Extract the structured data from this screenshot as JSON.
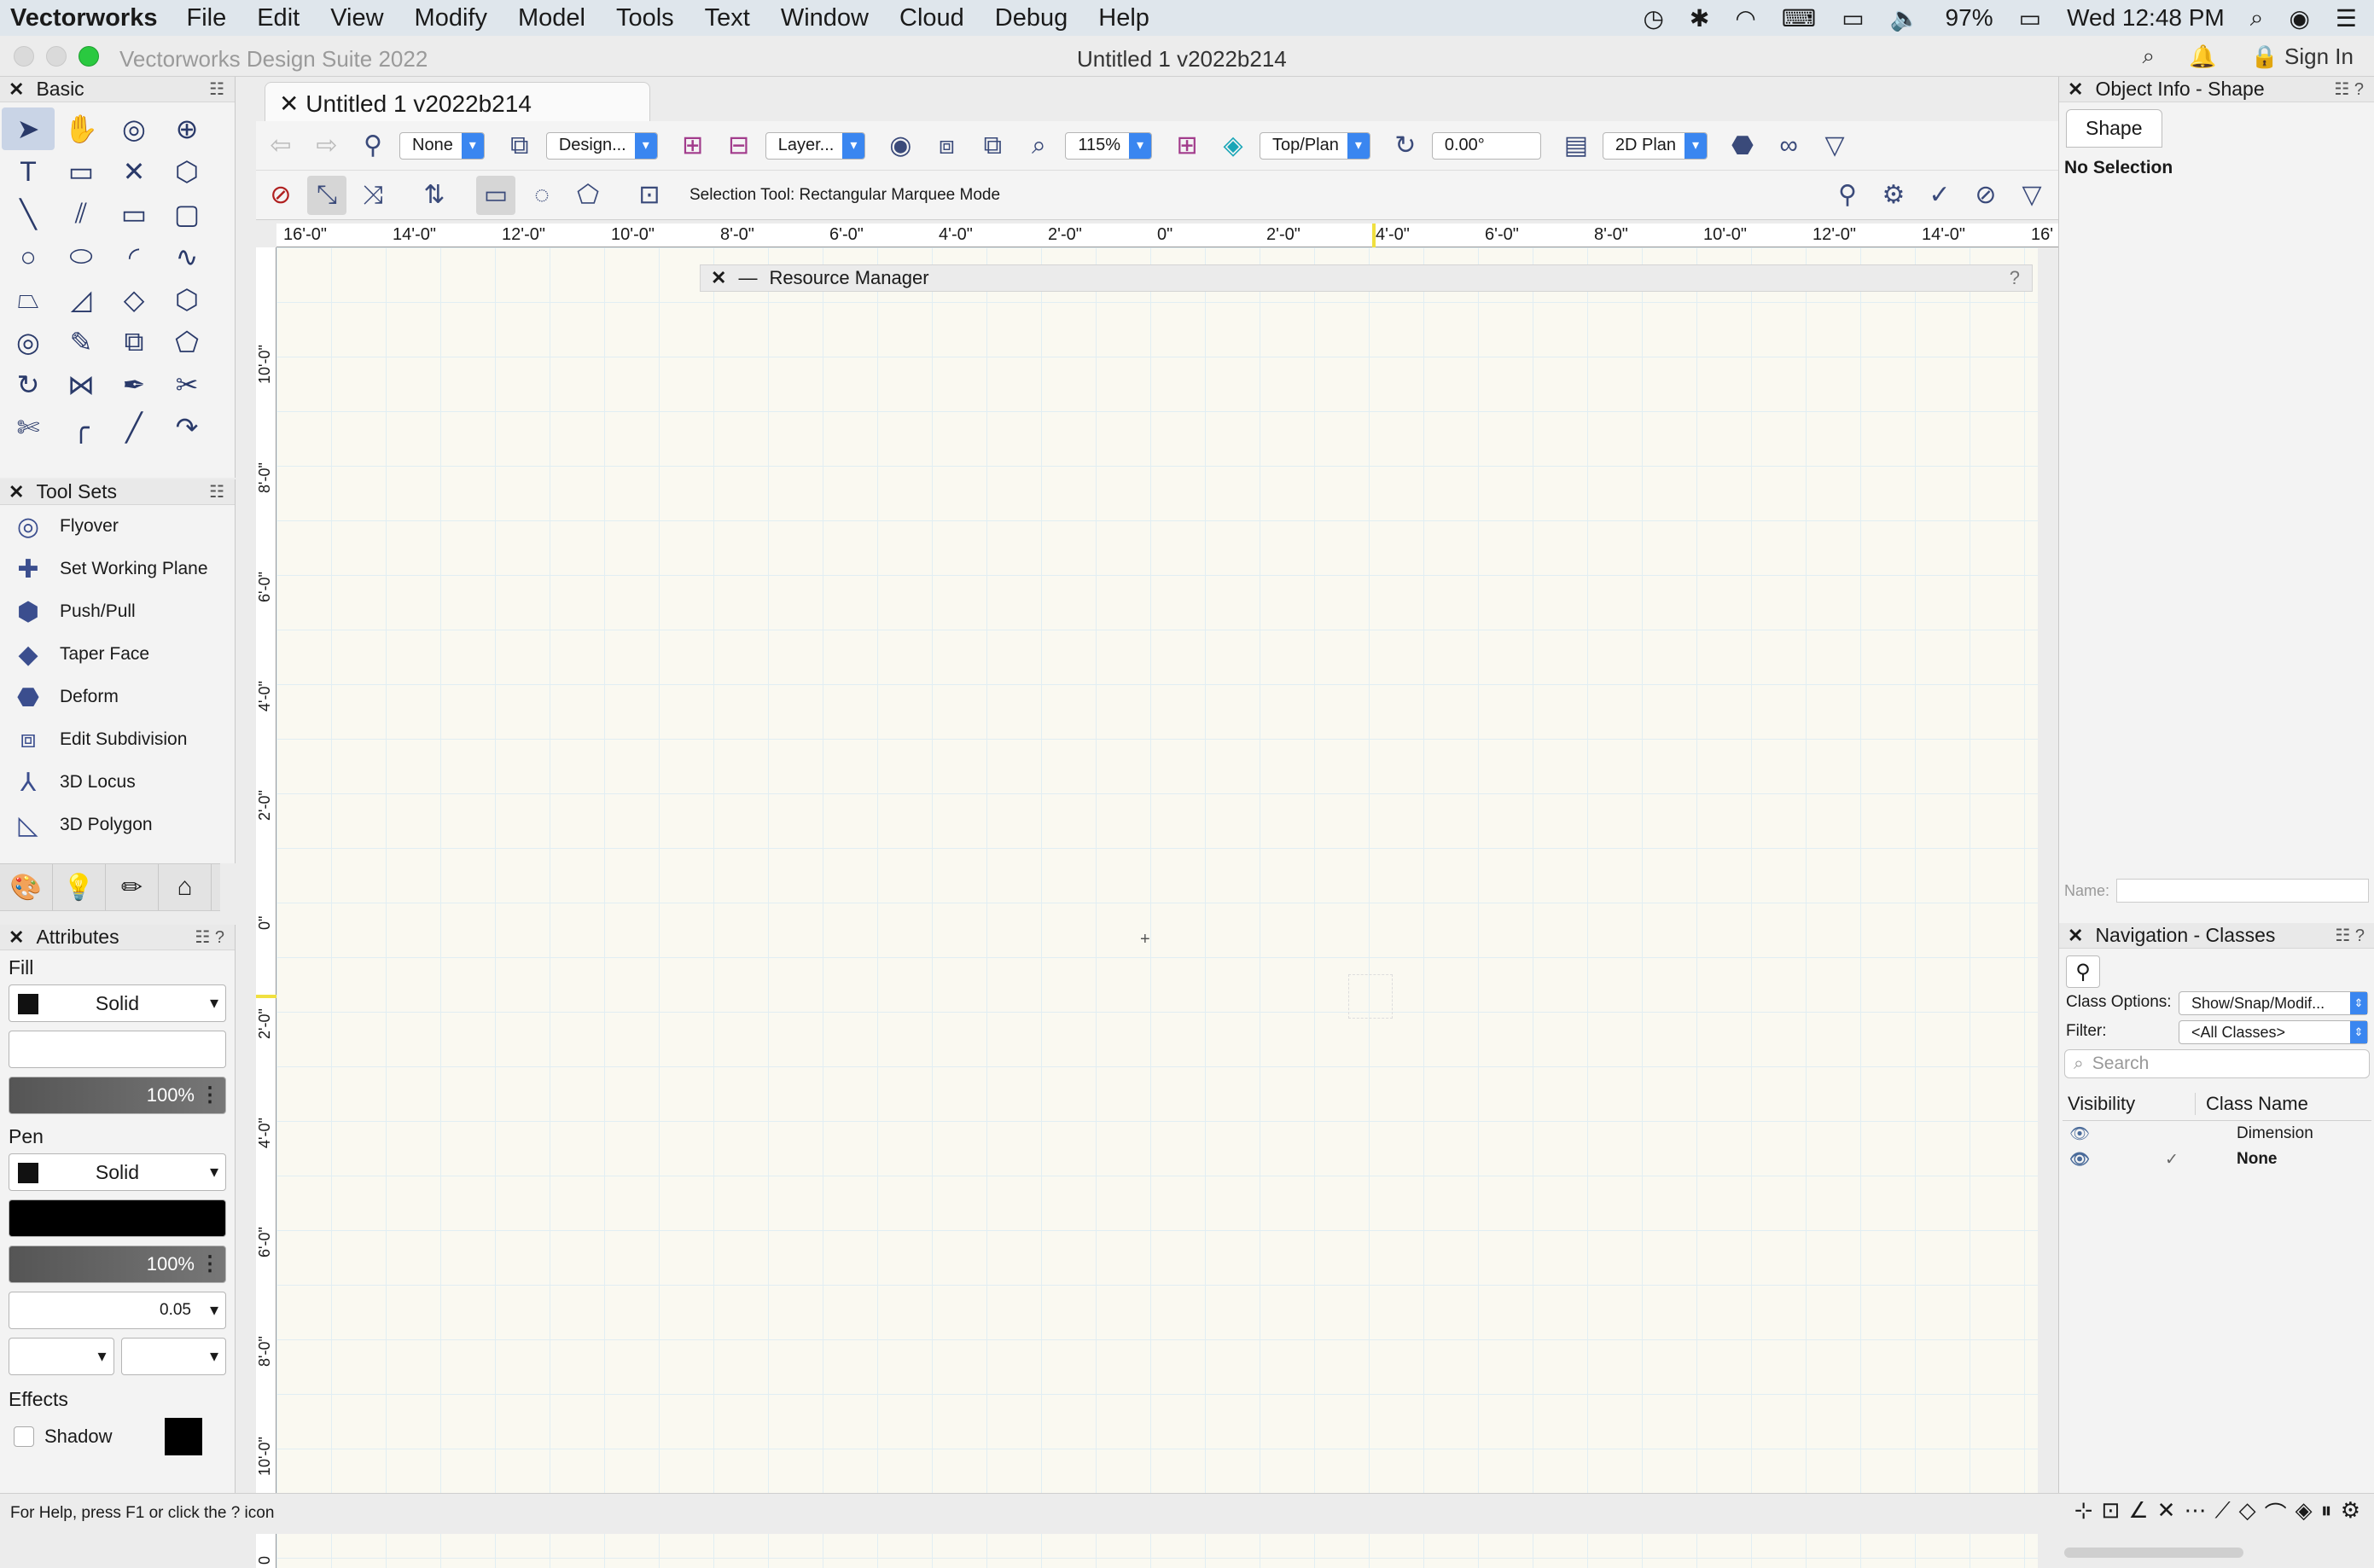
{
  "menubar": {
    "app": "Vectorworks",
    "items": [
      "File",
      "Edit",
      "View",
      "Modify",
      "Model",
      "Tools",
      "Text",
      "Window",
      "Cloud",
      "Debug",
      "Help"
    ],
    "battery": "97%",
    "clock": "Wed 12:48 PM"
  },
  "window": {
    "app_title": "Vectorworks Design Suite 2022",
    "doc_title": "Untitled 1 v2022b214",
    "sign_in": "Sign In"
  },
  "basic_palette": {
    "title": "Basic"
  },
  "tool_sets": {
    "title": "Tool Sets",
    "items": [
      "Flyover",
      "Set Working Plane",
      "Push/Pull",
      "Taper Face",
      "Deform",
      "Edit Subdivision",
      "3D Locus",
      "3D Polygon"
    ]
  },
  "attributes": {
    "title": "Attributes",
    "fill_label": "Fill",
    "fill_style": "Solid",
    "fill_opacity": "100%",
    "pen_label": "Pen",
    "pen_style": "Solid",
    "pen_opacity": "100%",
    "line_weight": "0.05",
    "effects_label": "Effects",
    "shadow_label": "Shadow"
  },
  "doc_tab": {
    "title": "Untitled 1 v2022b214"
  },
  "toolbar": {
    "class": "None",
    "design_layer": "Design...",
    "layer": "Layer...",
    "zoom": "115%",
    "view": "Top/Plan",
    "rotation": "0.00°",
    "render": "2D Plan"
  },
  "mode_bar": {
    "message": "Selection Tool: Rectangular Marquee Mode"
  },
  "ruler_h": [
    "16'-0\"",
    "14'-0\"",
    "12'-0\"",
    "10'-0\"",
    "8'-0\"",
    "6'-0\"",
    "4'-0\"",
    "2'-0\"",
    "0\"",
    "2'-0\"",
    "4'-0\"",
    "6'-0\"",
    "8'-0\"",
    "10'-0\"",
    "12'-0\"",
    "14'-0\"",
    "16'"
  ],
  "ruler_v": [
    "10'-0\"",
    "8'-0\"",
    "6'-0\"",
    "4'-0\"",
    "2'-0\"",
    "0\"",
    "2'-0\"",
    "4'-0\"",
    "6'-0\"",
    "8'-0\"",
    "10'-0\"",
    "0"
  ],
  "resource_manager": {
    "title": "Resource Manager"
  },
  "object_info": {
    "title": "Object Info - Shape",
    "tab": "Shape",
    "selection": "No Selection",
    "name_label": "Name:"
  },
  "navigation": {
    "title": "Navigation - Classes",
    "class_options_label": "Class Options:",
    "class_options_value": "Show/Snap/Modif...",
    "filter_label": "Filter:",
    "filter_value": "<All Classes>",
    "search_placeholder": "Search",
    "col_visibility": "Visibility",
    "col_class": "Class Name",
    "rows": [
      "Dimension",
      "None"
    ]
  },
  "status": {
    "help": "For Help, press F1 or click the ? icon"
  }
}
